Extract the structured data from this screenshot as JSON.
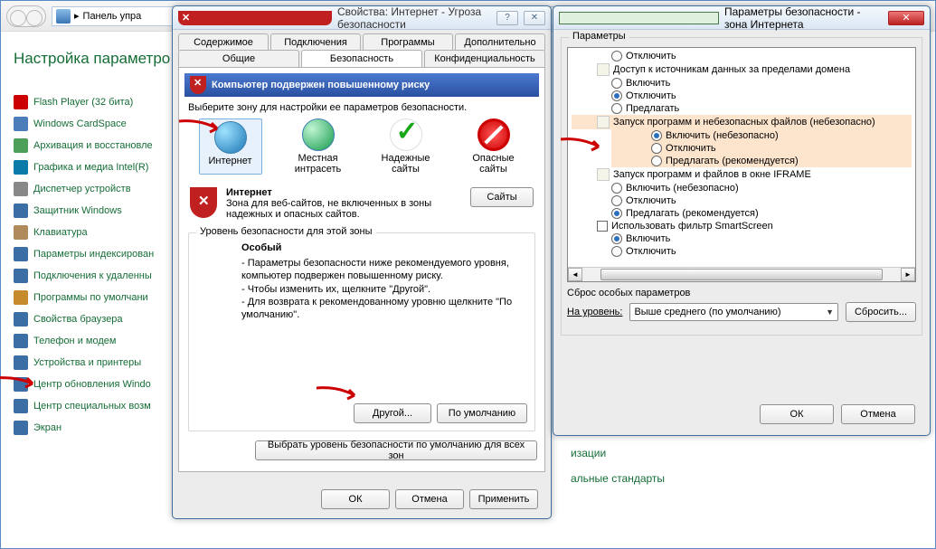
{
  "cp": {
    "breadcrumb_label": "Панель упра",
    "title": "Настройка параметро",
    "items": [
      {
        "icon": "ic-flash",
        "label": "Flash Player (32 бита)"
      },
      {
        "icon": "ic-card",
        "label": "Windows CardSpace"
      },
      {
        "icon": "ic-arch",
        "label": "Архивация и восстановле"
      },
      {
        "icon": "ic-intel",
        "label": "Графика и медиа Intel(R)"
      },
      {
        "icon": "ic-dev",
        "label": "Диспетчер устройств"
      },
      {
        "icon": "ic-def",
        "label": "Защитник Windows"
      },
      {
        "icon": "ic-kbd",
        "label": "Клавиатура"
      },
      {
        "icon": "ic-idx",
        "label": "Параметры индексирован"
      },
      {
        "icon": "ic-remote",
        "label": "Подключения к удаленны"
      },
      {
        "icon": "ic-default",
        "label": "Программы по умолчани"
      },
      {
        "icon": "ic-browser",
        "label": "Свойства браузера"
      },
      {
        "icon": "ic-phone",
        "label": "Телефон и модем"
      },
      {
        "icon": "ic-printer",
        "label": "Устройства и принтеры"
      },
      {
        "icon": "ic-update",
        "label": "Центр обновления Windo"
      },
      {
        "icon": "ic-special",
        "label": "Центр специальных возм"
      },
      {
        "icon": "ic-screen",
        "label": "Экран"
      }
    ],
    "right_frag1": "изации",
    "right_frag2": "альные стандарты"
  },
  "prop": {
    "title": "Свойства: Интернет - Угроза безопасности",
    "help": "?",
    "close": "✕",
    "tabs_row1": [
      "Содержимое",
      "Подключения",
      "Программы",
      "Дополнительно"
    ],
    "tabs_row2": [
      "Общие",
      "Безопасность",
      "Конфиденциальность"
    ],
    "active_tab": "Безопасность",
    "warning": "Компьютер подвержен повышенному риску",
    "zone_hint": "Выберите зону для настройки ее параметров безопасности.",
    "zones": [
      {
        "label": "Интернет",
        "icon": "zg-globe",
        "selected": true
      },
      {
        "label": "Местная интрасеть",
        "icon": "zg-globe g2"
      },
      {
        "label": "Надежные сайты",
        "icon": "zg-check"
      },
      {
        "label": "Опасные сайты",
        "icon": "zg-stop"
      }
    ],
    "zone_name": "Интернет",
    "zone_desc": "Зона для веб-сайтов, не включенных в зоны надежных и опасных сайтов.",
    "sites_btn": "Сайты",
    "sec_group_title": "Уровень безопасности для этой зоны",
    "level_name": "Особый",
    "level_desc": "- Параметры безопасности ниже рекомендуемого уровня, компьютер подвержен повышенному риску.\n- Чтобы изменить их, щелкните \"Другой\".\n- Для возврата к рекомендованному уровню щелкните \"По умолчанию\".",
    "btn_other": "Другой...",
    "btn_default": "По умолчанию",
    "btn_reset_all": "Выбрать уровень безопасности по умолчанию для всех зон",
    "ok": "ОК",
    "cancel": "Отмена",
    "apply": "Применить"
  },
  "sec": {
    "title": "Параметры безопасности - зона Интернета",
    "group_title": "Параметры",
    "tree": [
      {
        "lvl": 2,
        "type": "radio",
        "on": false,
        "label": "Отключить",
        "hl": false
      },
      {
        "lvl": 1,
        "type": "doc",
        "label": "Доступ к источникам данных за пределами домена",
        "hl": false
      },
      {
        "lvl": 2,
        "type": "radio",
        "on": false,
        "label": "Включить",
        "hl": false
      },
      {
        "lvl": 2,
        "type": "radio",
        "on": true,
        "label": "Отключить",
        "hl": false
      },
      {
        "lvl": 2,
        "type": "radio",
        "on": false,
        "label": "Предлагать",
        "hl": false
      },
      {
        "lvl": 1,
        "type": "doc",
        "label": "Запуск программ и небезопасных файлов (небезопасно)",
        "hl": true
      },
      {
        "lvl": 2,
        "type": "radio",
        "on": true,
        "label": "Включить (небезопасно)",
        "hl": true
      },
      {
        "lvl": 2,
        "type": "radio",
        "on": false,
        "label": "Отключить",
        "hl": true
      },
      {
        "lvl": 2,
        "type": "radio",
        "on": false,
        "label": "Предлагать (рекомендуется)",
        "hl": true
      },
      {
        "lvl": 1,
        "type": "doc",
        "label": "Запуск программ и файлов в окне IFRAME",
        "hl": false
      },
      {
        "lvl": 2,
        "type": "radio",
        "on": false,
        "label": "Включить (небезопасно)",
        "hl": false
      },
      {
        "lvl": 2,
        "type": "radio",
        "on": false,
        "label": "Отключить",
        "hl": false
      },
      {
        "lvl": 2,
        "type": "radio",
        "on": true,
        "label": "Предлагать (рекомендуется)",
        "hl": false
      },
      {
        "lvl": 1,
        "type": "check",
        "label": "Использовать фильтр SmartScreen",
        "hl": false
      },
      {
        "lvl": 2,
        "type": "radio",
        "on": true,
        "label": "Включить",
        "hl": false
      },
      {
        "lvl": 2,
        "type": "radio",
        "on": false,
        "label": "Отключить",
        "hl": false
      }
    ],
    "reset_title": "Сброс особых параметров",
    "reset_label": "На уровень:",
    "reset_value": "Выше среднего (по умолчанию)",
    "reset_btn": "Сбросить...",
    "ok": "ОК",
    "cancel": "Отмена"
  }
}
